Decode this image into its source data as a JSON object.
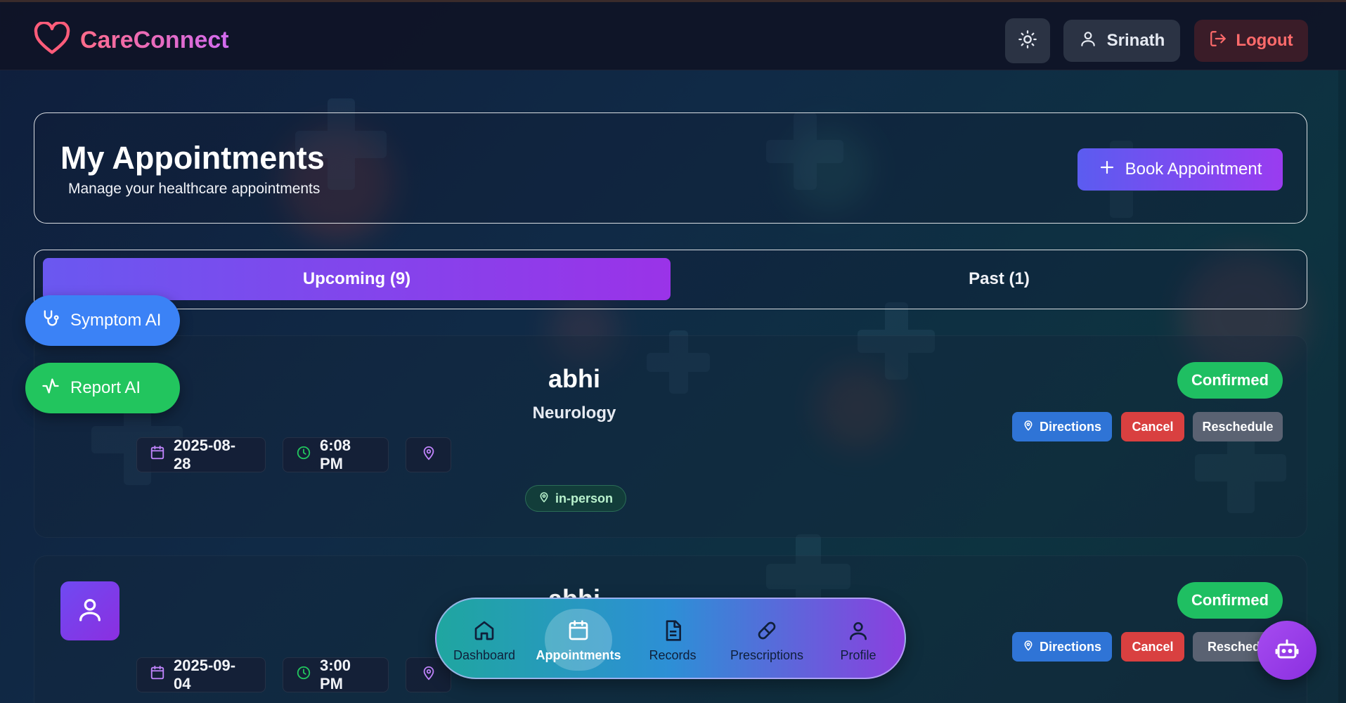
{
  "app": {
    "brand": "CareConnect"
  },
  "topbar": {
    "user_name": "Srinath",
    "logout_label": "Logout"
  },
  "header": {
    "title": "My Appointments",
    "subtitle": "Manage your healthcare appointments",
    "book_label": "Book Appointment"
  },
  "tabs": [
    {
      "label": "Upcoming (9)",
      "active": true
    },
    {
      "label": "Past (1)",
      "active": false
    }
  ],
  "floating": {
    "symptom_ai": "Symptom AI",
    "report_ai": "Report AI"
  },
  "appointments": [
    {
      "doctor": "abhi",
      "specialty": "Neurology",
      "date": "2025-08-28",
      "time": "6:08 PM",
      "mode": "in-person",
      "status": "Confirmed",
      "actions": {
        "directions": "Directions",
        "cancel": "Cancel",
        "reschedule": "Reschedule"
      }
    },
    {
      "doctor": "abhi",
      "date": "2025-09-04",
      "time": "3:00 PM",
      "status": "Confirmed",
      "actions": {
        "directions": "Directions",
        "cancel": "Cancel",
        "reschedule": "Reschedu"
      }
    }
  ],
  "bottom_nav": [
    {
      "label": "Dashboard",
      "icon": "home-icon"
    },
    {
      "label": "Appointments",
      "icon": "calendar-icon",
      "active": true
    },
    {
      "label": "Records",
      "icon": "document-icon"
    },
    {
      "label": "Prescriptions",
      "icon": "pill-icon"
    },
    {
      "label": "Profile",
      "icon": "user-icon"
    }
  ],
  "colors": {
    "accent": "#6a58f0",
    "confirmed": "#1fbf62",
    "directions": "#2f74d6",
    "cancel": "#d94040",
    "reschedule": "#5a6272",
    "logout": "#ff6b6b"
  }
}
